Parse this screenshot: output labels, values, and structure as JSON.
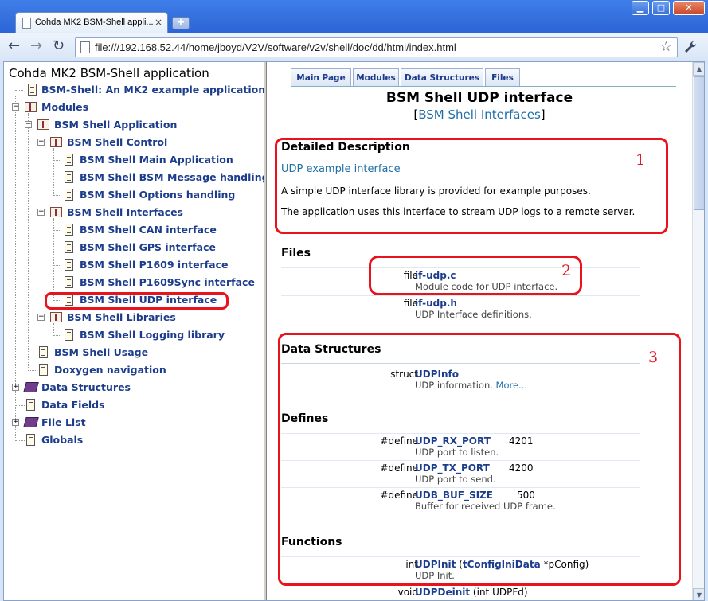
{
  "browser": {
    "tab_title": "Cohda MK2 BSM-Shell appli...",
    "tab_close": "×",
    "new_tab": "+",
    "address_url": "file:///192.168.52.44/home/jboyd/V2V/software/v2v/shell/doc/dd/html/index.html",
    "window_controls": {
      "minimize": "▁",
      "maximize": "□",
      "close": "✕"
    },
    "nav": {
      "back": "←",
      "forward": "→",
      "reload": "↻",
      "star": "☆",
      "wrench": "🔧"
    },
    "icons": [
      "page-icon",
      "back-arrow-icon",
      "forward-arrow-icon",
      "reload-icon",
      "star-icon",
      "wrench-icon"
    ]
  },
  "tree": {
    "title": "Cohda MK2 BSM-Shell application",
    "items": [
      {
        "label": "BSM-Shell: An MK2 example application",
        "icon": "doc"
      },
      {
        "label": "Modules",
        "icon": "folder",
        "toggle": "−"
      },
      {
        "label": "BSM Shell Application",
        "icon": "folder",
        "toggle": "−"
      },
      {
        "label": "BSM Shell Control",
        "icon": "folder",
        "toggle": "−"
      },
      {
        "label": "BSM Shell Main Application",
        "icon": "doc"
      },
      {
        "label": "BSM Shell BSM Message handling",
        "icon": "doc"
      },
      {
        "label": "BSM Shell Options handling",
        "icon": "doc"
      },
      {
        "label": "BSM Shell Interfaces",
        "icon": "folder",
        "toggle": "−"
      },
      {
        "label": "BSM Shell CAN interface",
        "icon": "doc"
      },
      {
        "label": "BSM Shell GPS interface",
        "icon": "doc"
      },
      {
        "label": "BSM Shell P1609 interface",
        "icon": "doc"
      },
      {
        "label": "BSM Shell P1609Sync interface",
        "icon": "doc"
      },
      {
        "label": "BSM Shell UDP interface",
        "icon": "doc"
      },
      {
        "label": "BSM Shell Libraries",
        "icon": "folder",
        "toggle": "−"
      },
      {
        "label": "BSM Shell Logging library",
        "icon": "doc"
      },
      {
        "label": "BSM Shell Usage",
        "icon": "doc"
      },
      {
        "label": "Doxygen navigation",
        "icon": "doc"
      },
      {
        "label": "Data Structures",
        "icon": "book",
        "toggle": "+"
      },
      {
        "label": "Data Fields",
        "icon": "doc"
      },
      {
        "label": "File List",
        "icon": "book",
        "toggle": "+"
      },
      {
        "label": "Globals",
        "icon": "doc"
      }
    ]
  },
  "doc": {
    "tabs": [
      "Main Page",
      "Modules",
      "Data Structures",
      "Files"
    ],
    "title": "BSM Shell UDP interface",
    "crumb_open": "[",
    "crumb_link": "BSM Shell Interfaces",
    "crumb_close": "]",
    "detailed": {
      "heading": "Detailed Description",
      "brief": "UDP example interface",
      "para1": "A simple UDP interface library is provided for example purposes.",
      "para2": "The application uses this interface to stream UDP logs to a remote server."
    },
    "files": {
      "heading": "Files",
      "rows": [
        {
          "kind": "file",
          "name": "if-udp.c",
          "desc": "Module code for UDP interface."
        },
        {
          "kind": "file",
          "name": "if-udp.h",
          "desc": "UDP Interface definitions."
        }
      ]
    },
    "structures": {
      "heading": "Data Structures",
      "rows": [
        {
          "kind": "struct",
          "name": "UDPInfo",
          "desc": "UDP information.",
          "more": "More..."
        }
      ]
    },
    "defines": {
      "heading": "Defines",
      "rows": [
        {
          "kind": "#define",
          "name": "UDP_RX_PORT",
          "value": "4201",
          "desc": "UDP port to listen."
        },
        {
          "kind": "#define",
          "name": "UDP_TX_PORT",
          "value": "4200",
          "desc": "UDP port to send."
        },
        {
          "kind": "#define",
          "name": "UDB_BUF_SIZE",
          "value": "500",
          "desc": "Buffer for received UDP frame."
        }
      ]
    },
    "functions": {
      "heading": "Functions",
      "rows": [
        {
          "kind": "int",
          "name": "UDPInit",
          "p1": " (",
          "arg_link": "tConfigIniData",
          "p2": " *pConfig)",
          "desc": "UDP Init."
        },
        {
          "kind": "void",
          "name": "UDPDeinit",
          "p1": " (int UDPFd)"
        }
      ]
    }
  },
  "annotations": {
    "color": "#e8131c",
    "labels": [
      "1",
      "2",
      "3"
    ]
  },
  "colors": {
    "link": "#1c3c8c",
    "brief_link": "#1f6ea8",
    "annotation": "#e8131c"
  }
}
